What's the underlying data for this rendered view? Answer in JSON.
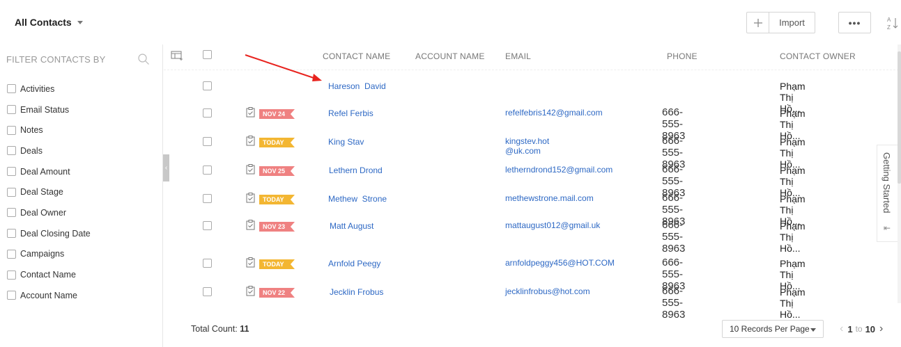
{
  "header": {
    "view_title": "All Contacts",
    "import_label": "Import",
    "more_label": "•••"
  },
  "sidebar": {
    "title": "FILTER CONTACTS BY",
    "items": [
      {
        "label": "Activities"
      },
      {
        "label": "Email Status"
      },
      {
        "label": "Notes"
      },
      {
        "label": "Deals"
      },
      {
        "label": "Deal Amount"
      },
      {
        "label": "Deal Stage"
      },
      {
        "label": "Deal Owner"
      },
      {
        "label": "Deal Closing Date"
      },
      {
        "label": "Campaigns"
      },
      {
        "label": "Contact Name"
      },
      {
        "label": "Account Name"
      }
    ]
  },
  "table": {
    "columns": {
      "contact_name": "CONTACT NAME",
      "account_name": "ACCOUNT NAME",
      "email": "EMAIL",
      "phone": "PHONE",
      "contact_owner": "CONTACT OWNER"
    },
    "rows": [
      {
        "badge": "",
        "badge_color": "",
        "name": "Hareson  David",
        "email": "",
        "phone": "",
        "owner": "Phạm Thị Hồ..."
      },
      {
        "badge": "NOV 24",
        "badge_color": "#ef8181",
        "name": "Refel Ferbis",
        "email": "refelfebris142@gmail.com",
        "phone": "666-555-8963",
        "owner": "Phạm Thị Hồ..."
      },
      {
        "badge": "TODAY",
        "badge_color": "#f3b632",
        "name": "King Stav",
        "email": "kingstev.hot @uk.com",
        "phone": "666-555-8963",
        "owner": "Phạm Thị Hồ..."
      },
      {
        "badge": "NOV 25",
        "badge_color": "#ef8181",
        "name": "Lethern Drond",
        "email": "letherndrond152@gmail.com",
        "phone": "666-555-8963",
        "owner": "Phạm Thị Hồ..."
      },
      {
        "badge": "TODAY",
        "badge_color": "#f3b632",
        "name": "Methew  Strone",
        "email": "methewstrone.mail.com",
        "phone": "666-555-8963",
        "owner": "Phạm Thị Hồ..."
      },
      {
        "badge": "NOV 23",
        "badge_color": "#ef8181",
        "name": "Matt August",
        "email": "mattaugust012@gmail.uk",
        "phone": "666-555-8963",
        "owner": "Phạm Thị Hồ..."
      },
      {
        "badge": "TODAY",
        "badge_color": "#f3b632",
        "name": "Arnfold Peegy",
        "email": "arnfoldpeggy456@HOT.COM",
        "phone": "666-555-8963",
        "owner": "Phạm Thị Hồ..."
      },
      {
        "badge": "NOV 22",
        "badge_color": "#ef8181",
        "name": "Jecklin Frobus",
        "email": "jecklinfrobus@hot.com",
        "phone": "666-555-8963",
        "owner": "Phạm Thị Hồ..."
      }
    ]
  },
  "side_tab": {
    "label": "Getting Started"
  },
  "footer": {
    "total_label": "Total Count:",
    "total_value": "11",
    "per_page": "10 Records Per Page",
    "page_from": "1",
    "page_to_label": "to",
    "page_to": "10"
  },
  "icons": {
    "plus": "plus-icon",
    "more": "more-icon",
    "sort": "sort-az-icon",
    "search": "search-icon",
    "column_settings": "column-settings-icon",
    "task": "task-clipboard-icon",
    "collapse": "chevron-left-icon",
    "side_tab": "collapse-panel-icon"
  },
  "colors": {
    "link": "#2d68c4",
    "badge_red": "#ef8181",
    "badge_yellow": "#f3b632",
    "annotation_arrow": "#e8231e"
  }
}
